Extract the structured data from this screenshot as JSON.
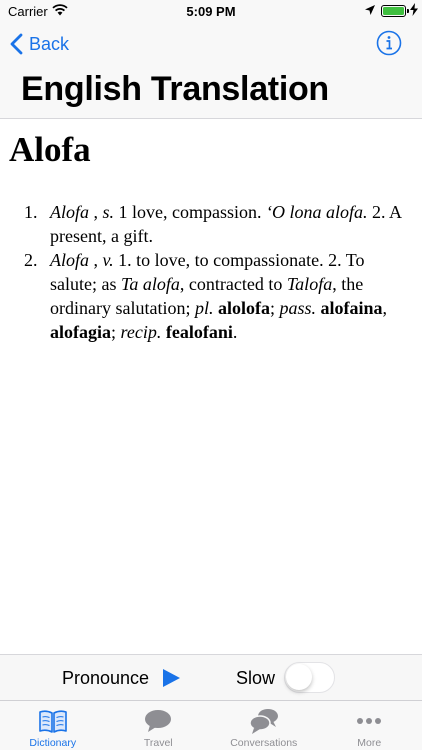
{
  "status_bar": {
    "carrier": "Carrier",
    "time": "5:09 PM"
  },
  "nav": {
    "back_label": "Back"
  },
  "header": {
    "title": "English Translation"
  },
  "entry": {
    "word": "Alofa",
    "definitions": [
      {
        "number": "1.",
        "segments": [
          {
            "text": "Alofa",
            "style": "italic"
          },
          {
            "text": " , ",
            "style": "normal"
          },
          {
            "text": "s.",
            "style": "italic"
          },
          {
            "text": " 1 love, compassion. ",
            "style": "normal"
          },
          {
            "text": "‘O lona alofa.",
            "style": "italic"
          },
          {
            "text": " 2. A present, a gift.",
            "style": "normal"
          }
        ]
      },
      {
        "number": "2.",
        "segments": [
          {
            "text": "Alofa",
            "style": "italic"
          },
          {
            "text": " , ",
            "style": "normal"
          },
          {
            "text": "v.",
            "style": "italic"
          },
          {
            "text": " 1. to love, to compassionate. 2. To salute; as ",
            "style": "normal"
          },
          {
            "text": "Ta alofa",
            "style": "italic"
          },
          {
            "text": ", contracted to ",
            "style": "normal"
          },
          {
            "text": "Talofa",
            "style": "italic"
          },
          {
            "text": ", the ordinary salutation; ",
            "style": "normal"
          },
          {
            "text": "pl.",
            "style": "italic"
          },
          {
            "text": " ",
            "style": "normal"
          },
          {
            "text": "alolofa",
            "style": "bold"
          },
          {
            "text": "; ",
            "style": "normal"
          },
          {
            "text": "pass.",
            "style": "italic"
          },
          {
            "text": " ",
            "style": "normal"
          },
          {
            "text": "alofaina",
            "style": "bold"
          },
          {
            "text": ", ",
            "style": "normal"
          },
          {
            "text": "alofagia",
            "style": "bold"
          },
          {
            "text": "; ",
            "style": "normal"
          },
          {
            "text": "recip.",
            "style": "italic"
          },
          {
            "text": " ",
            "style": "normal"
          },
          {
            "text": "fealofani",
            "style": "bold"
          },
          {
            "text": ".",
            "style": "normal"
          }
        ]
      }
    ]
  },
  "pronounce_bar": {
    "pronounce_label": "Pronounce",
    "slow_label": "Slow",
    "slow_on": false
  },
  "tabs": [
    {
      "label": "Dictionary",
      "icon": "book-icon",
      "active": true
    },
    {
      "label": "Travel",
      "icon": "speech-bubble-icon",
      "active": false
    },
    {
      "label": "Conversations",
      "icon": "conversation-bubbles-icon",
      "active": false
    },
    {
      "label": "More",
      "icon": "more-dots-icon",
      "active": false
    }
  ],
  "colors": {
    "accent": "#1a73e8",
    "inactive": "#8e8e93",
    "battery": "#3fbf3f"
  }
}
